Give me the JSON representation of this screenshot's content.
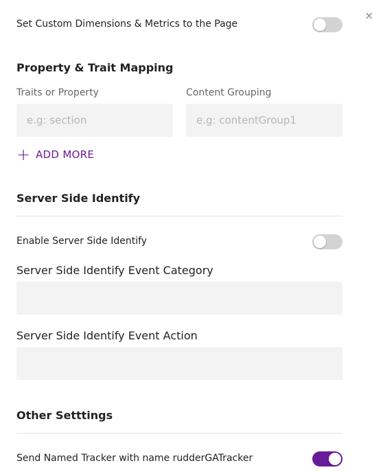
{
  "close_icon": "×",
  "custom_dimensions": {
    "label": "Set Custom Dimensions & Metrics to the Page",
    "enabled": false
  },
  "mapping": {
    "title": "Property & Trait Mapping",
    "col1_label": "Traits or Property",
    "col2_label": "Content Grouping",
    "col1_placeholder": "e.g: section",
    "col2_placeholder": "e.g: contentGroup1",
    "add_more_icon": "+",
    "add_more_label": "ADD MORE"
  },
  "server_side": {
    "title": "Server Side Identify",
    "enable_label": "Enable Server Side Identify",
    "enabled": false,
    "category_label": "Server Side Identify Event Category",
    "category_value": "",
    "action_label": "Server Side Identify Event Action",
    "action_value": ""
  },
  "other": {
    "title": "Other Setttings",
    "named_tracker_label": "Send Named Tracker with name rudderGATracker",
    "named_tracker_enabled": true
  },
  "colors": {
    "accent": "#6a1b9a",
    "toggle_off": "#d3d3d3",
    "input_bg": "#f3f3f3"
  }
}
